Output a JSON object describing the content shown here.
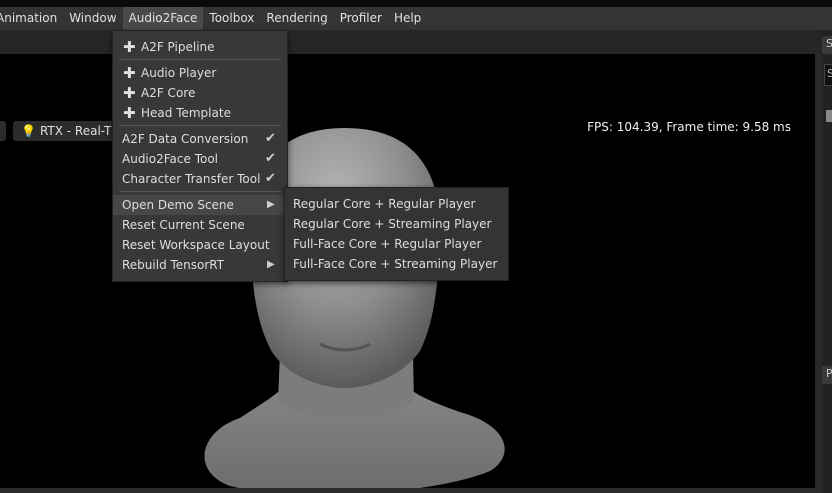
{
  "menubar": {
    "items": [
      "Animation",
      "Window",
      "Audio2Face",
      "Toolbox",
      "Rendering",
      "Profiler",
      "Help"
    ]
  },
  "viewport": {
    "renderer_label": "RTX - Real-Time",
    "fps_text": "FPS: 104.39, Frame time: 9.58 ms"
  },
  "audio2face_menu": {
    "items": [
      {
        "label": "A2F Pipeline",
        "icon": "plus-icon"
      },
      {
        "label": "Audio Player",
        "icon": "plus-icon"
      },
      {
        "label": "A2F Core",
        "icon": "plus-icon"
      },
      {
        "label": "Head Template",
        "icon": "plus-icon"
      },
      {
        "label": "A2F Data Conversion",
        "checked": true
      },
      {
        "label": "Audio2Face Tool",
        "checked": true
      },
      {
        "label": "Character Transfer Tool",
        "checked": true
      },
      {
        "label": "Open Demo Scene",
        "submenu": true,
        "highlighted": true
      },
      {
        "label": "Reset Current Scene"
      },
      {
        "label": "Reset Workspace Layout"
      },
      {
        "label": "Rebuild TensorRT",
        "submenu": true
      }
    ]
  },
  "demo_scene_submenu": {
    "items": [
      "Regular Core + Regular Player",
      "Regular Core + Streaming Player",
      "Full-Face Core + Regular Player",
      "Full-Face Core + Streaming Player"
    ]
  },
  "right_panel": {
    "tab_initial": "S",
    "field_initial": "S",
    "tab2_initial": "P"
  },
  "icons": {
    "check": "✔",
    "arrow": "▶",
    "plus": "✚",
    "bulb": "💡"
  },
  "colors": {
    "menubar_bg": "#343434",
    "menu_bg": "#383838",
    "viewport_bg": "#000000"
  }
}
